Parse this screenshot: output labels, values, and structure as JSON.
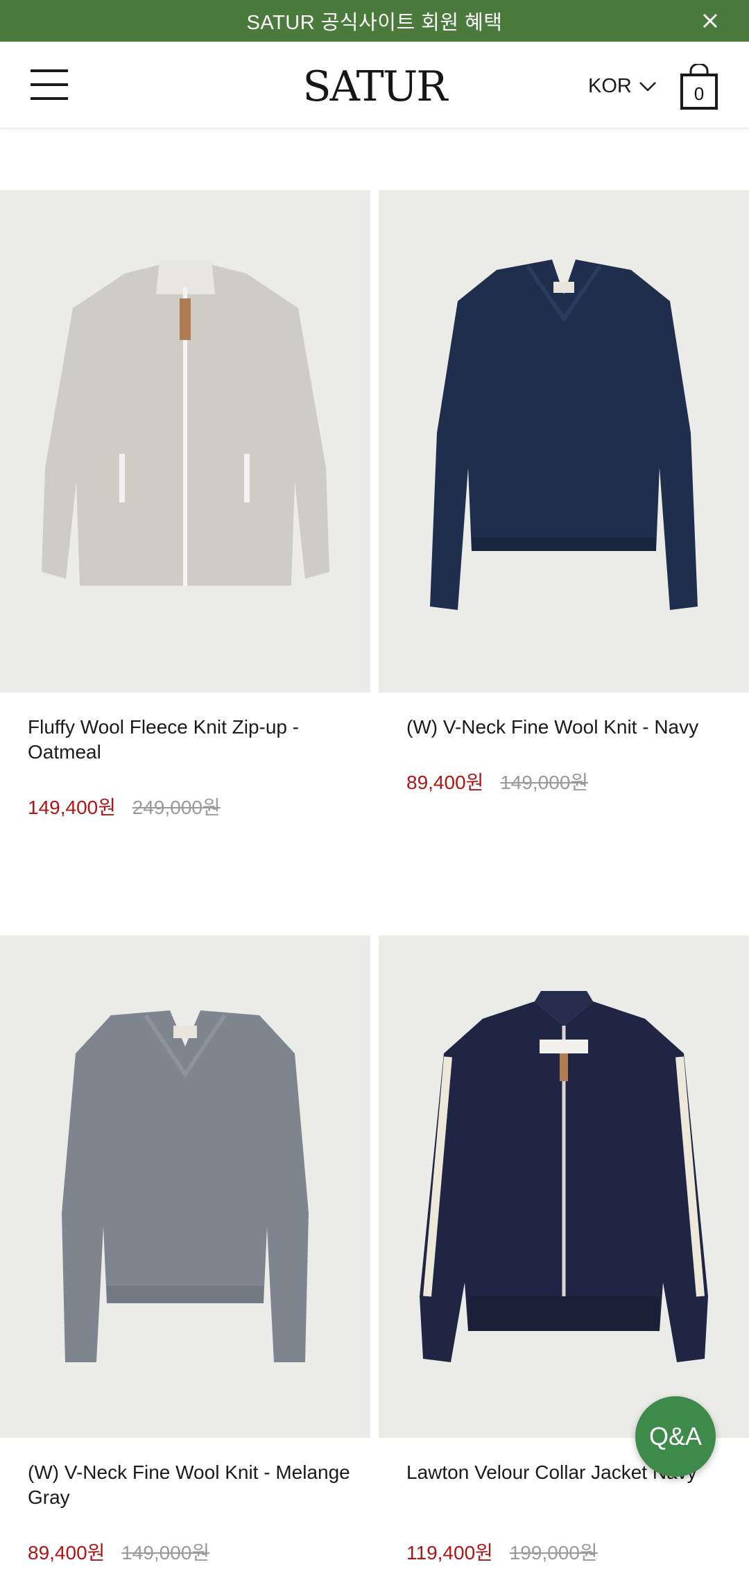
{
  "banner": {
    "text": "SATUR 공식사이트 회원 혜택",
    "close_icon": "close-icon"
  },
  "header": {
    "logo": "SATUR",
    "language": "KOR",
    "cart_count": "0"
  },
  "products": [
    {
      "name": "Fluffy Wool Fleece Knit Zip-up - Oatmeal",
      "sale_price": "149,400원",
      "original_price": "249,000원",
      "image": "oatmeal-zip-up-knit"
    },
    {
      "name": "(W) V-Neck Fine Wool Knit - Navy",
      "sale_price": "89,400원",
      "original_price": "149,000원",
      "image": "navy-v-neck-knit"
    },
    {
      "name": "(W) V-Neck Fine Wool Knit - Melange Gray",
      "sale_price": "89,400원",
      "original_price": "149,000원",
      "image": "gray-v-neck-knit"
    },
    {
      "name": "Lawton Velour Collar Jacket Navy",
      "sale_price": "119,400원",
      "original_price": "199,000원",
      "image": "navy-velour-jacket"
    }
  ],
  "qa_button": {
    "label": "Q&A"
  },
  "colors": {
    "banner": "#4a7a3c",
    "sale": "#b01515",
    "qa": "#3e8a4a"
  }
}
